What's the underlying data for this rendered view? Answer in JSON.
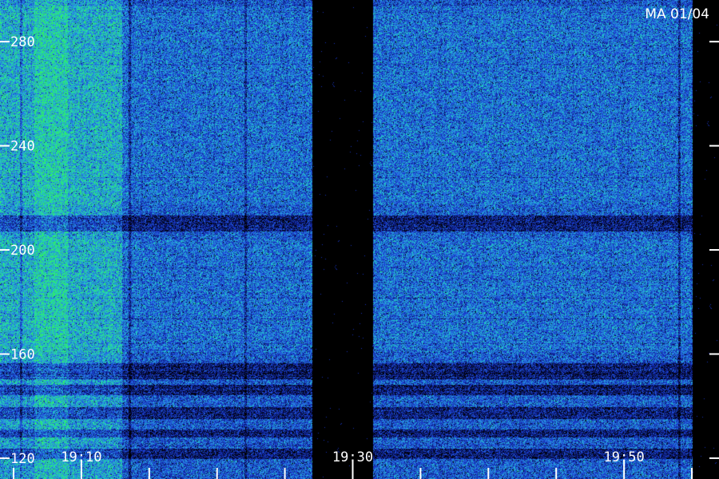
{
  "chart_data": {
    "type": "heatmap",
    "title": "",
    "xlabel": "",
    "ylabel": "",
    "corner_label": "MA 01/04",
    "x_range": [
      "19:04",
      "19:57"
    ],
    "y_range": [
      112,
      296
    ],
    "x_major_tick_labels": [
      "19:10",
      "19:30",
      "19:50"
    ],
    "x_minor_ticks": [
      "19:05",
      "19:15",
      "19:20",
      "19:25",
      "19:35",
      "19:40",
      "19:45",
      "19:55"
    ],
    "y_tick_labels": [
      120,
      160,
      200,
      240,
      280
    ],
    "grid": false,
    "colorscale": [
      "#000000",
      "#0a1670",
      "#1a3cd0",
      "#2a80e8",
      "#20d0c0",
      "#30f060"
    ],
    "intensity_regions": [
      {
        "from": "19:04",
        "to": "19:06.5",
        "level": "high"
      },
      {
        "from": "19:06.5",
        "to": "19:09",
        "level": "very-high"
      },
      {
        "from": "19:09",
        "to": "19:13",
        "level": "high"
      },
      {
        "from": "19:13",
        "to": "19:27",
        "level": "medium"
      },
      {
        "from": "19:27",
        "to": "19:31.5",
        "level": "gap"
      },
      {
        "from": "19:31.5",
        "to": "19:55",
        "level": "medium"
      },
      {
        "from": "19:55",
        "to": "19:57",
        "level": "gap"
      }
    ]
  }
}
